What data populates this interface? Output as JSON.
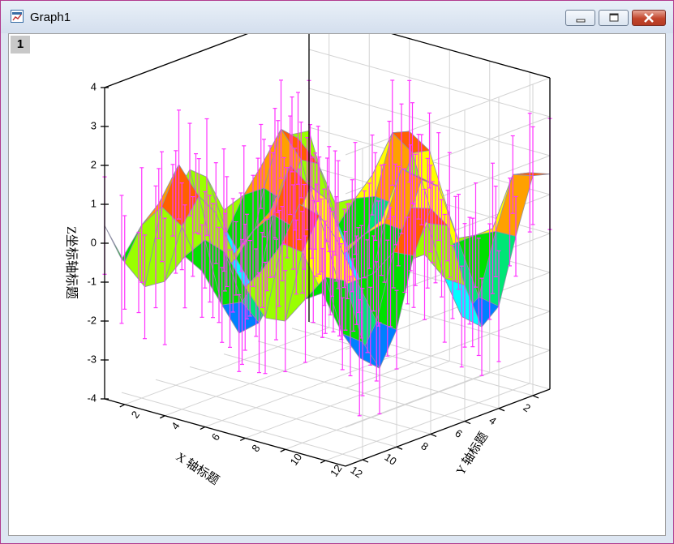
{
  "window": {
    "title": "Graph1",
    "layer_label": "1"
  },
  "icons": {
    "app": "graph-window-icon",
    "minimize": "minimize-icon",
    "maximize": "maximize-icon",
    "close": "close-icon"
  },
  "colors": {
    "errorbar": "#ff33ff",
    "mesh": "#8f8fa6",
    "grid": "#d3d3d3",
    "bands": [
      "#0000ee",
      "#0080ff",
      "#00ffff",
      "#00e676",
      "#00e000",
      "#99ff00",
      "#ffff00",
      "#ffa000",
      "#ff6000",
      "#ff0000"
    ]
  },
  "chart_data": {
    "type": "3d-surface-with-error-bars",
    "surface_function": "z = 2*sin(x)*cos(y)",
    "x_range": [
      1,
      13
    ],
    "y_range": [
      1,
      13
    ],
    "z_range": [
      -4,
      4
    ],
    "xlabel": "X 轴标题",
    "ylabel": "Y 轴标题",
    "zlabel": "Z坐标轴标题",
    "x_ticks": [
      "2",
      "4",
      "6",
      "8",
      "10",
      "12"
    ],
    "y_ticks": [
      "2",
      "4",
      "6",
      "8",
      "10",
      "12"
    ],
    "z_ticks": [
      "4",
      "3",
      "2",
      "1",
      "0",
      "-1",
      "-2",
      "-3",
      "-4"
    ],
    "colormap_levels": [
      -2,
      -1.6,
      -1.2,
      -0.8,
      -0.4,
      0,
      0.4,
      0.8,
      1.2,
      1.6,
      2
    ],
    "error_bars": "vertical error bars drawn at each mesh node, roughly ±1 to ±1.6 in z",
    "grid": true,
    "legend": "none"
  }
}
